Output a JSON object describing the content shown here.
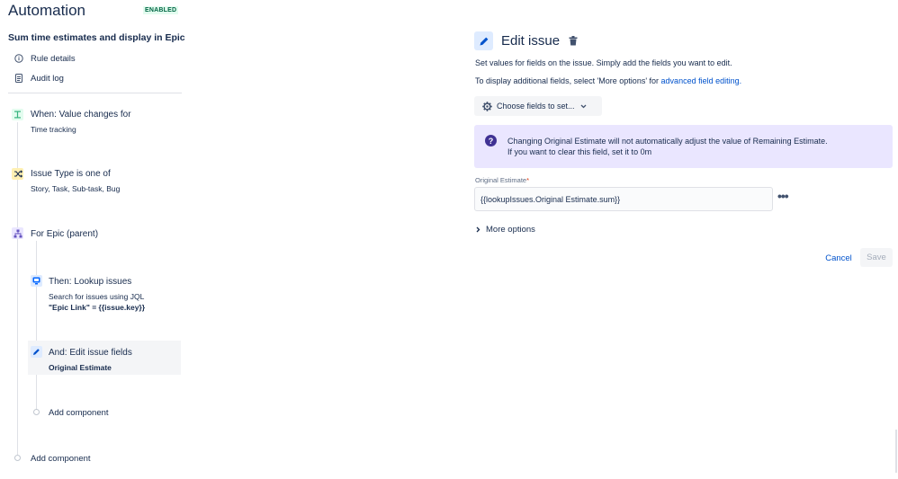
{
  "header": {
    "app_title": "Automation",
    "status_badge": "ENABLED",
    "rule_name": "Sum time estimates and display in Epic"
  },
  "nav": {
    "rule_details": "Rule details",
    "audit_log": "Audit log"
  },
  "flow": {
    "trigger": {
      "title": "When: Value changes for",
      "subtitle": "Time tracking",
      "icon": "trigger-icon"
    },
    "condition": {
      "title": "Issue Type is one of",
      "subtitle": "Story, Task, Sub-task, Bug",
      "icon": "shuffle-icon"
    },
    "branch": {
      "title": "For Epic (parent)",
      "icon": "hierarchy-icon"
    },
    "lookup": {
      "title": "Then: Lookup issues",
      "subtitle": "Search for issues using JQL",
      "jql": "\"Epic Link\" = {{issue.key}}",
      "icon": "lookup-icon"
    },
    "edit": {
      "title": "And: Edit issue fields",
      "subtitle": "Original Estimate",
      "icon": "pencil-icon"
    },
    "add_component_inner": "Add component",
    "add_component_outer": "Add component"
  },
  "editor": {
    "title": "Edit issue",
    "help_text_1": "Set values for fields on the issue. Simply add the fields you want to edit.",
    "help_text_2_prefix": "To display additional fields, select 'More options' for ",
    "help_text_2_link": "advanced field editing.",
    "choose_fields_label": "Choose fields to set...",
    "info_line_1": "Changing Original Estimate will not automatically adjust the value of Remaining Estimate.",
    "info_line_2": "If you want to clear this field, set it to 0m",
    "field_label": "Original Estimate",
    "field_required_mark": "*",
    "field_value": "{{lookupIssues.Original Estimate.sum}}",
    "field_more": "•••",
    "more_options_label": "More options",
    "cancel_label": "Cancel",
    "save_label": "Save"
  },
  "colors": {
    "text": "#172b4d",
    "link": "#0052cc",
    "enabled_text": "#006644",
    "enabled_bg": "#e3fcef",
    "info_bg": "#eae6ff",
    "info_icon": "#403294",
    "trigger_icon": "#36b37e",
    "condition_icon": "#ffab00",
    "branch_icon": "#6554c0",
    "action_icon": "#0065ff"
  }
}
